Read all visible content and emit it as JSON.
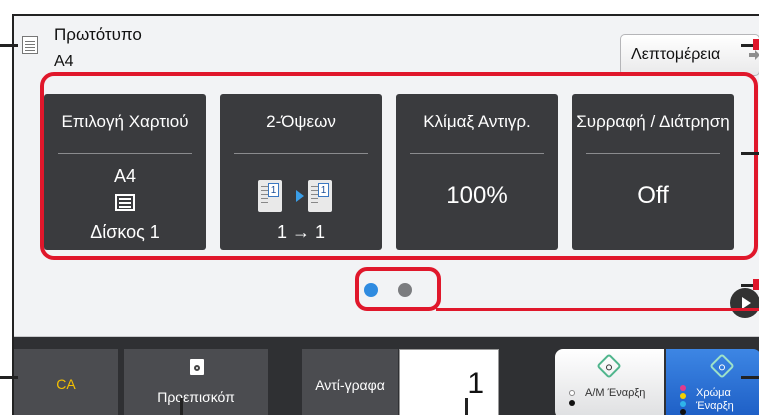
{
  "original": {
    "label": "Πρωτότυπο",
    "size": "A4"
  },
  "details_button": "Λεπτομέρεια",
  "tiles": [
    {
      "title": "Επιλογή Χαρτιού",
      "value": "A4",
      "sub": "Δίσκος 1",
      "icon": "paper-tray-icon"
    },
    {
      "title": "2-Όψεων",
      "sub": "1 → 1",
      "icon": "duplex-icon"
    },
    {
      "title": "Κλίμαξ Αντιγρ.",
      "value": "100%"
    },
    {
      "title": "Συρραφή / Διάτρηση",
      "value": "Off"
    }
  ],
  "page_indicator": {
    "pages": 2,
    "current": 1
  },
  "bottom_bar": {
    "ca": "CA",
    "preview": "Προεπισκόπ",
    "copies_label": "Αντί-γραφα",
    "copies_value": "1",
    "bw_start": "Α/Μ Έναρξη",
    "color_start": "Χρώμα Έναρξη"
  },
  "colors": {
    "accent_red": "#e0172b",
    "tile_bg": "#3a3b3e",
    "color_start": "#2a6fd4",
    "ca_text": "#f5c000"
  }
}
